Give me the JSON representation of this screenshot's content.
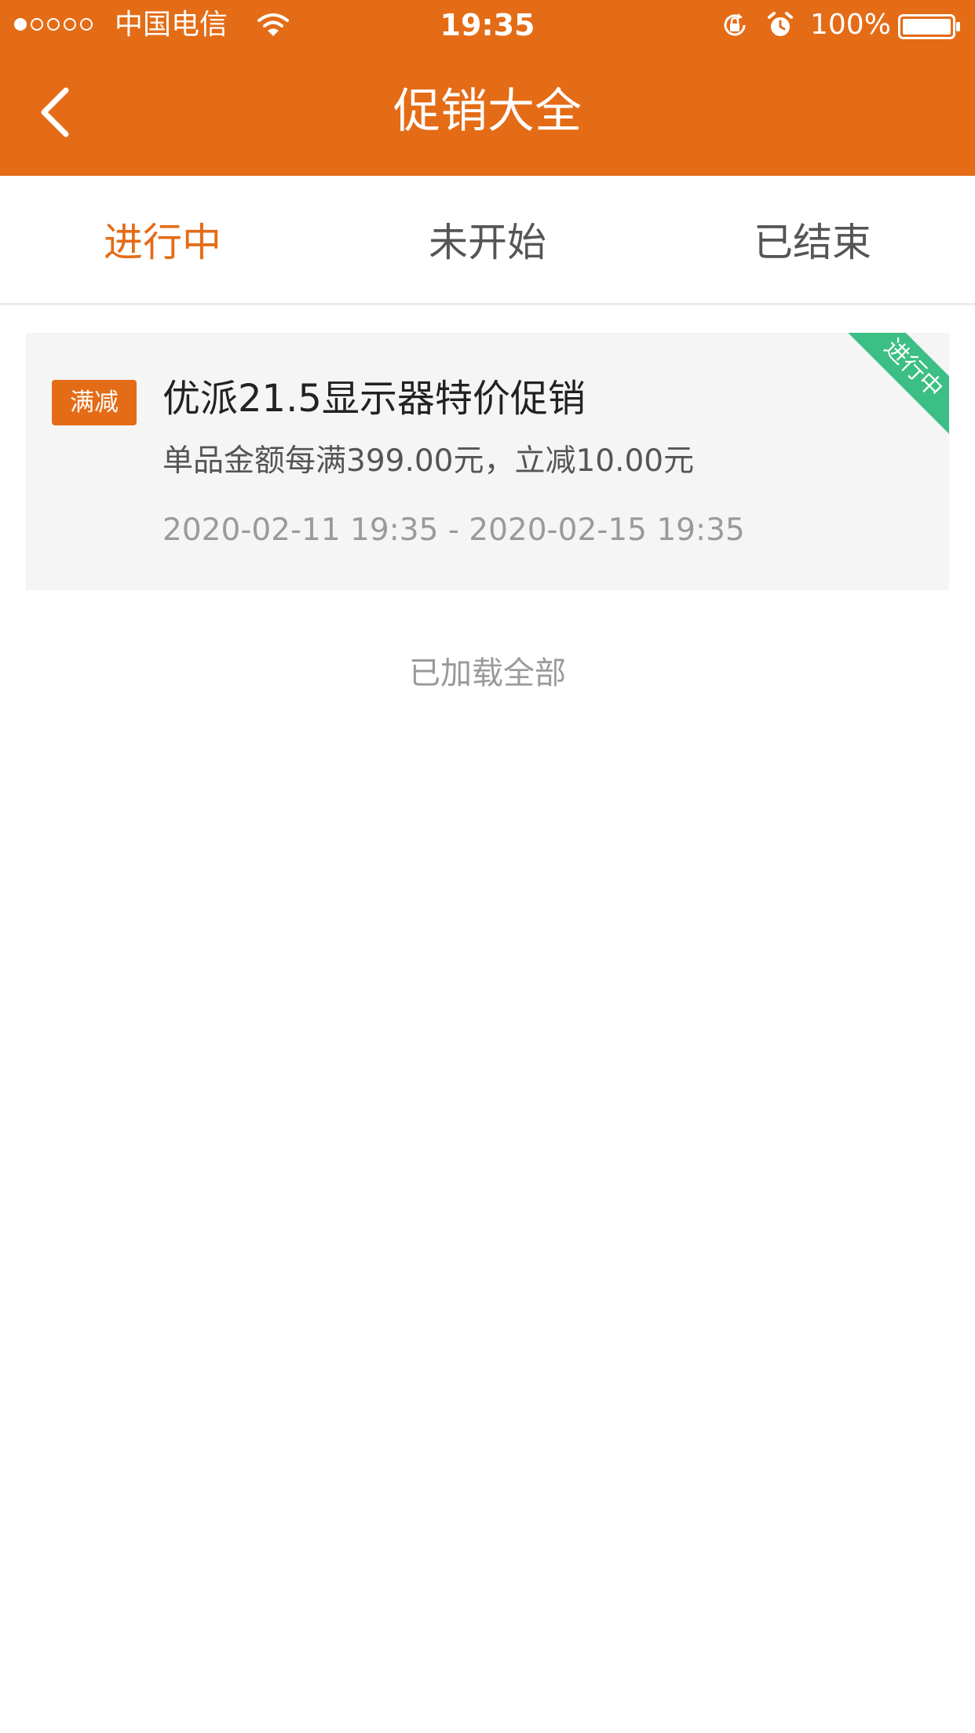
{
  "status_bar": {
    "carrier": "中国电信",
    "time": "19:35",
    "battery": "100%",
    "icons": [
      "signal-dots-icon",
      "wifi-icon",
      "rotation-lock-icon",
      "alarm-icon",
      "battery-icon"
    ]
  },
  "nav": {
    "title": "促销大全",
    "back_icon": "chevron-left-icon"
  },
  "tabs": [
    {
      "label": "进行中",
      "active": true
    },
    {
      "label": "未开始",
      "active": false
    },
    {
      "label": "已结束",
      "active": false
    }
  ],
  "promotions": [
    {
      "tag": "满减",
      "title": "优派21.5显示器特价促销",
      "rule": "单品金额每满399.00元，立减10.00元",
      "period": "2020-02-11 19:35 - 2020-02-15 19:35",
      "status_ribbon": "进行中"
    }
  ],
  "footer": "已加载全部",
  "colors": {
    "brand": "#e46c17",
    "ribbon_green": "#3cbf84",
    "card_bg": "#f5f5f5",
    "muted_text": "#9a9a9a"
  }
}
